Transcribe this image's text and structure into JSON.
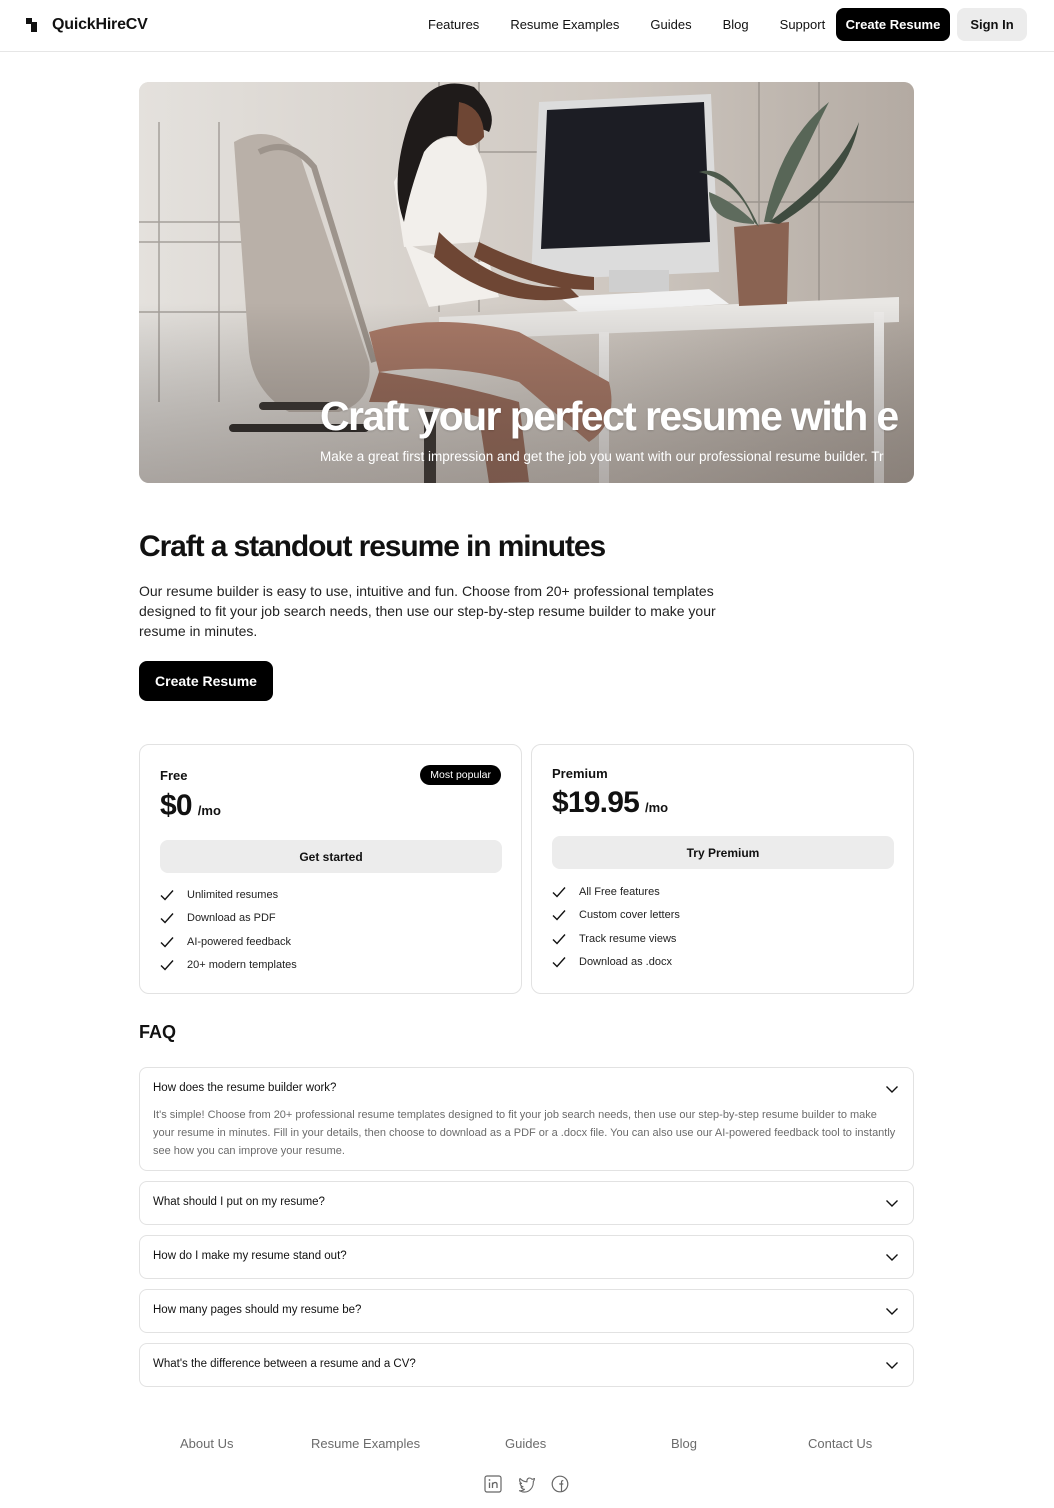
{
  "header": {
    "brand": "QuickHireCV",
    "nav": [
      "Features",
      "Resume Examples",
      "Guides",
      "Blog",
      "Support"
    ],
    "create_label": "Create Resume",
    "signin_label": "Sign In"
  },
  "hero": {
    "title": "Craft your perfect resume with e",
    "subtitle": "Make a great first impression and get the job you want with our professional resume builder. Tr"
  },
  "intro": {
    "title": "Craft a standout resume in minutes",
    "text": "Our resume builder is easy to use, intuitive and fun. Choose from 20+ professional templates designed to fit your job search needs, then use our step-by-step resume builder to make your resume in minutes.",
    "button": "Create Resume"
  },
  "plans": [
    {
      "name": "Free",
      "badge": "Most popular",
      "price": "$0",
      "period": "/mo",
      "button": "Get started",
      "features": [
        "Unlimited resumes",
        "Download as PDF",
        "AI-powered feedback",
        "20+ modern templates"
      ]
    },
    {
      "name": "Premium",
      "price": "$19.95",
      "period": "/mo",
      "button": "Try Premium",
      "features": [
        "All Free features",
        "Custom cover letters",
        "Track resume views",
        "Download as .docx"
      ]
    }
  ],
  "faq": {
    "title": "FAQ",
    "items": [
      {
        "question": "How does the resume builder work?",
        "answer": "It's simple! Choose from 20+ professional resume templates designed to fit your job search needs, then use our step-by-step resume builder to make your resume in minutes. Fill in your details, then choose to download as a PDF or a .docx file. You can also use our AI-powered feedback tool to instantly see how you can improve your resume."
      },
      {
        "question": "What should I put on my resume?"
      },
      {
        "question": "How do I make my resume stand out?"
      },
      {
        "question": "How many pages should my resume be?"
      },
      {
        "question": "What's the difference between a resume and a CV?"
      }
    ]
  },
  "footer": {
    "links": [
      "About Us",
      "Resume Examples",
      "Guides",
      "Blog",
      "Contact Us"
    ],
    "social_icons": [
      "linkedin-icon",
      "twitter-icon",
      "facebook-icon"
    ]
  }
}
